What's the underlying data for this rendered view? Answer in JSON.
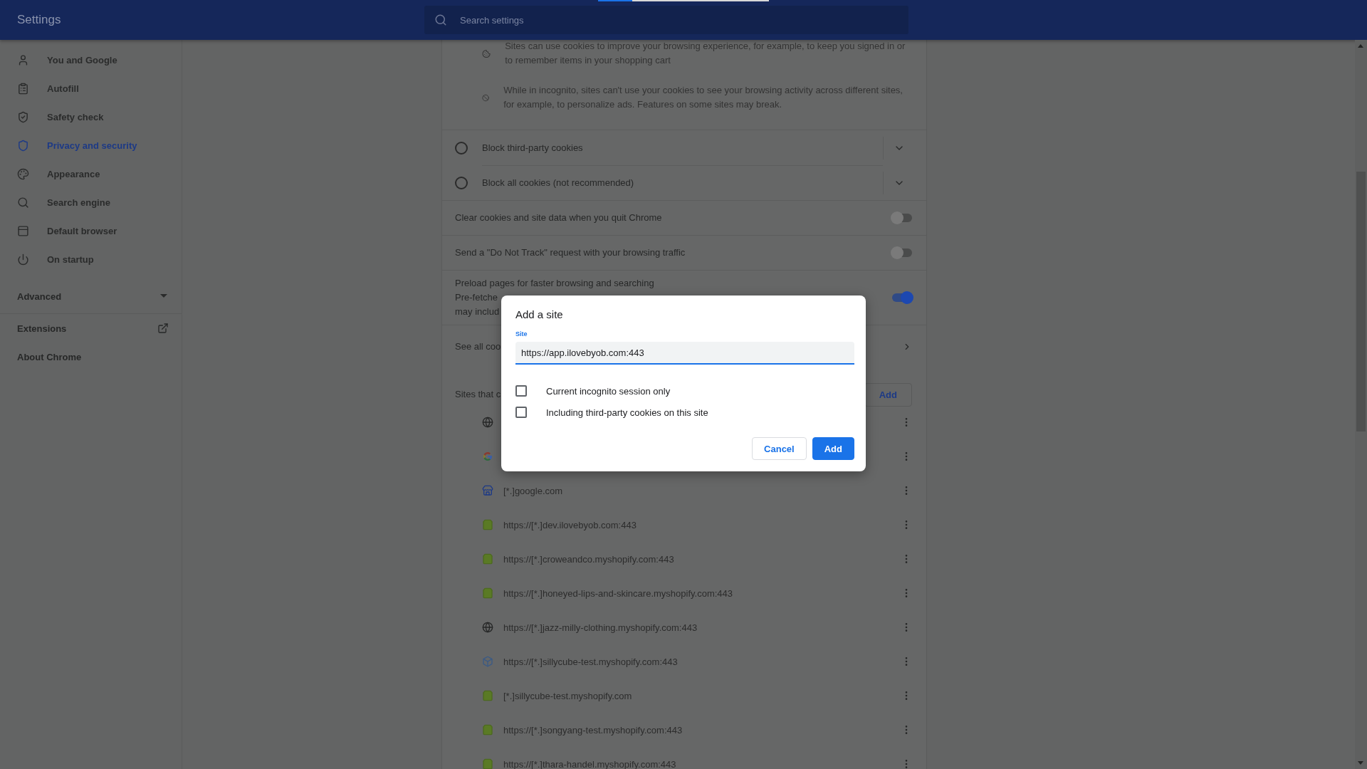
{
  "header": {
    "title": "Settings",
    "search": {
      "placeholder": "Search settings"
    }
  },
  "sidebar": {
    "items": [
      {
        "label": "You and Google",
        "selected": false
      },
      {
        "label": "Autofill",
        "selected": false
      },
      {
        "label": "Safety check",
        "selected": false
      },
      {
        "label": "Privacy and security",
        "selected": true
      },
      {
        "label": "Appearance",
        "selected": false
      },
      {
        "label": "Search engine",
        "selected": false
      },
      {
        "label": "Default browser",
        "selected": false
      },
      {
        "label": "On startup",
        "selected": false
      }
    ],
    "advanced": {
      "label": "Advanced",
      "expanded": false
    },
    "links": [
      "Extensions",
      "About Chrome"
    ]
  },
  "content": {
    "notes": [
      "Sites can use cookies to improve your browsing experience, for example, to keep you signed in or to remember items in your shopping cart",
      "While in incognito, sites can't use your cookies to see your browsing activity across different sites, for example, to personalize ads. Features on some sites may break."
    ],
    "options": [
      {
        "label": "Block third-party cookies",
        "selected": false
      },
      {
        "label": "Block all cookies (not recommended)",
        "selected": false
      }
    ],
    "toggles": [
      {
        "label": "Clear cookies and site data when you quit Chrome",
        "on": false
      },
      {
        "label": "Send a \"Do Not Track\" request with your browsing traffic",
        "on": false
      },
      {
        "label": "Preload pages for faster browsing and searching",
        "on": true,
        "lines": [
          "Pre-fetche",
          "may includ"
        ]
      }
    ],
    "see_all": "See all coo",
    "sites_heading": "Sites that c",
    "add_button": "Add",
    "sites": [
      {
        "kind": "globe"
      },
      {
        "kind": "google"
      },
      {
        "kind": "store",
        "url": "[*.]google.com"
      },
      {
        "kind": "shop",
        "url": "https://[*.]dev.ilovebyob.com:443"
      },
      {
        "kind": "shop",
        "url": "https://[*.]croweandco.myshopify.com:443"
      },
      {
        "kind": "shop",
        "url": "https://[*.]honeyed-lips-and-skincare.myshopify.com:443"
      },
      {
        "kind": "globe",
        "url": "https://[*.]jazz-milly-clothing.myshopify.com:443"
      },
      {
        "kind": "cube",
        "url": "https://[*.]sillycube-test.myshopify.com:443"
      },
      {
        "kind": "shop",
        "url": "[*.]sillycube-test.myshopify.com"
      },
      {
        "kind": "shop",
        "url": "https://[*.]songyang-test.myshopify.com:443"
      },
      {
        "kind": "shop",
        "url": "https://[*.]thara-handel.myshopify.com:443"
      }
    ]
  },
  "dialog": {
    "title": "Add a site",
    "field_label": "Site",
    "value": "https://app.ilovebyob.com:443",
    "checkboxes": [
      {
        "label": "Current incognito session only",
        "checked": false
      },
      {
        "label": "Including third-party cookies on this site",
        "checked": false
      }
    ],
    "buttons": [
      {
        "label": "Cancel",
        "kind": "secondary"
      },
      {
        "label": "Add",
        "kind": "primary"
      }
    ]
  }
}
